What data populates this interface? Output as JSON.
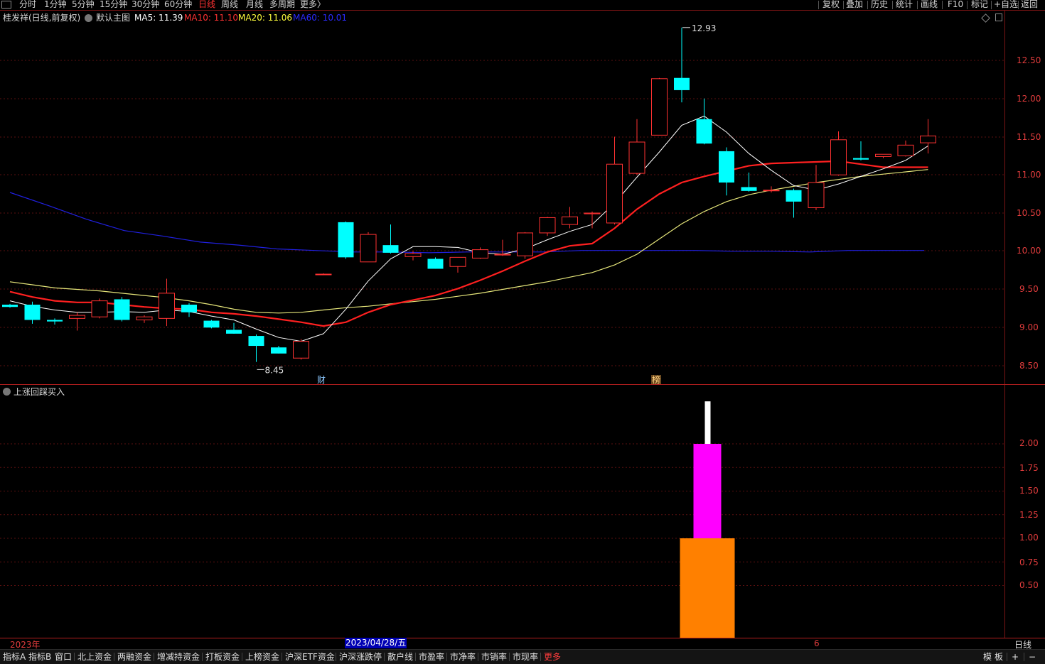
{
  "toolbar": {
    "app_icon": "window-icon",
    "periods": [
      "分时",
      "1分钟",
      "5分钟",
      "15分钟",
      "30分钟",
      "60分钟",
      "日线",
      "周线",
      "月线",
      "多周期",
      "更多"
    ],
    "active_period": "日线",
    "more_suffix": "〉",
    "right_tools": [
      "复权",
      "叠加",
      "历史",
      "统计",
      "画线",
      "F10",
      "标记",
      "+自选",
      "返回"
    ]
  },
  "main_info": {
    "stock": "桂发祥(日线,前复权)",
    "template": "默认主图",
    "ma5": "MA5: 11.39",
    "ma10": "MA10: 11.10",
    "ma20": "MA20: 11.06",
    "ma60": "MA60: 10.01"
  },
  "colors": {
    "up": "#ff3232",
    "down": "#00ffff",
    "ma5": "#ffffff",
    "ma10": "#ff2020",
    "ma20": "#e6e67a",
    "ma60": "#2020e0",
    "axis": "#e03c3c",
    "frame": "#7a1414",
    "grid": "#5a1010"
  },
  "price_axis": {
    "ticks": [
      "12.50",
      "12.00",
      "11.50",
      "11.00",
      "10.50",
      "10.00",
      "9.50",
      "9.00",
      "8.50"
    ],
    "range": [
      8.4,
      12.95
    ]
  },
  "annotations": {
    "high_label": "12.93",
    "low_label": "8.45",
    "cai_marker": "财",
    "bang_marker": "榜"
  },
  "indicator": {
    "name": "上涨回踩买入",
    "ticks": [
      "2.00",
      "1.75",
      "1.50",
      "1.25",
      "1.00",
      "0.75",
      "0.50"
    ],
    "range": [
      -0.5,
      2.4
    ]
  },
  "chart_data": {
    "type": "candlestick",
    "ohlc": [
      [
        9.3,
        9.31,
        9.26,
        9.27
      ],
      [
        9.3,
        9.34,
        9.05,
        9.1
      ],
      [
        9.1,
        9.12,
        9.04,
        9.08
      ],
      [
        9.12,
        9.2,
        8.96,
        9.16
      ],
      [
        9.14,
        9.38,
        9.12,
        9.35
      ],
      [
        9.37,
        9.4,
        9.08,
        9.1
      ],
      [
        9.1,
        9.16,
        9.06,
        9.14
      ],
      [
        9.12,
        9.64,
        9.02,
        9.45
      ],
      [
        9.3,
        9.32,
        9.14,
        9.2
      ],
      [
        9.09,
        9.1,
        8.99,
        9.0
      ],
      [
        8.97,
        9.06,
        8.92,
        8.92
      ],
      [
        8.89,
        8.91,
        8.55,
        8.76
      ],
      [
        8.74,
        8.76,
        8.66,
        8.66
      ],
      [
        8.6,
        8.85,
        8.58,
        8.82
      ],
      [
        9.7,
        9.71,
        9.69,
        9.7
      ],
      [
        10.38,
        10.39,
        9.9,
        9.92
      ],
      [
        9.86,
        10.25,
        9.87,
        10.22
      ],
      [
        10.08,
        10.35,
        9.97,
        9.98
      ],
      [
        9.93,
        10.0,
        9.88,
        9.97
      ],
      [
        9.9,
        9.92,
        9.77,
        9.77
      ],
      [
        9.8,
        9.92,
        9.72,
        9.92
      ],
      [
        9.91,
        10.05,
        9.9,
        10.02
      ],
      [
        9.95,
        10.15,
        9.94,
        9.96
      ],
      [
        9.94,
        10.25,
        9.9,
        10.24
      ],
      [
        10.24,
        10.45,
        10.2,
        10.44
      ],
      [
        10.35,
        10.58,
        10.3,
        10.45
      ],
      [
        10.49,
        10.52,
        10.3,
        10.5
      ],
      [
        10.37,
        11.5,
        10.35,
        11.14
      ],
      [
        11.02,
        11.73,
        11.0,
        11.43
      ],
      [
        11.52,
        12.27,
        11.52,
        12.26
      ],
      [
        12.27,
        12.93,
        11.95,
        12.11
      ],
      [
        11.73,
        12.0,
        11.4,
        11.41
      ],
      [
        11.31,
        11.36,
        10.73,
        10.9
      ],
      [
        10.84,
        11.03,
        10.78,
        10.79
      ],
      [
        10.8,
        10.85,
        10.77,
        10.8
      ],
      [
        10.8,
        10.82,
        10.44,
        10.65
      ],
      [
        10.57,
        11.13,
        10.54,
        10.9
      ],
      [
        11.0,
        11.57,
        10.99,
        11.46
      ],
      [
        11.22,
        11.44,
        11.19,
        11.2
      ],
      [
        11.24,
        11.25,
        11.22,
        11.27
      ],
      [
        11.25,
        11.45,
        11.24,
        11.39
      ],
      [
        11.42,
        11.73,
        11.28,
        11.51
      ]
    ],
    "ma5": [
      9.35,
      9.28,
      9.23,
      9.2,
      9.2,
      9.21,
      9.2,
      9.23,
      9.21,
      9.15,
      9.1,
      8.98,
      8.87,
      8.82,
      8.92,
      9.24,
      9.61,
      9.9,
      10.06,
      10.06,
      10.05,
      9.98,
      9.96,
      10.03,
      10.15,
      10.26,
      10.35,
      10.63,
      10.97,
      11.3,
      11.65,
      11.77,
      11.56,
      11.28,
      11.06,
      10.86,
      10.8,
      10.88,
      10.98,
      11.08,
      11.19,
      11.38
    ],
    "ma10": [
      9.47,
      9.4,
      9.35,
      9.33,
      9.33,
      9.3,
      9.27,
      9.25,
      9.24,
      9.2,
      9.18,
      9.15,
      9.11,
      9.07,
      9.02,
      9.07,
      9.2,
      9.3,
      9.36,
      9.42,
      9.51,
      9.62,
      9.74,
      9.87,
      9.99,
      10.07,
      10.1,
      10.3,
      10.55,
      10.75,
      10.9,
      10.98,
      11.05,
      11.12,
      11.15,
      11.16,
      11.17,
      11.18,
      11.14,
      11.1,
      11.1,
      11.1
    ],
    "ma20": [
      9.6,
      9.56,
      9.52,
      9.5,
      9.48,
      9.45,
      9.42,
      9.39,
      9.35,
      9.3,
      9.24,
      9.2,
      9.19,
      9.2,
      9.23,
      9.26,
      9.28,
      9.31,
      9.34,
      9.37,
      9.41,
      9.45,
      9.5,
      9.55,
      9.6,
      9.66,
      9.72,
      9.82,
      9.96,
      10.16,
      10.36,
      10.52,
      10.65,
      10.74,
      10.8,
      10.85,
      10.9,
      10.94,
      10.98,
      11.01,
      11.04,
      11.07
    ],
    "ma60": [
      10.77,
      10.6,
      10.42,
      10.27,
      10.2,
      10.12,
      10.08,
      10.03,
      10.01,
      9.99,
      9.99,
      9.98,
      9.99,
      9.99,
      9.99,
      10.01,
      10.01,
      10.01,
      10.01,
      10.0,
      10.0,
      9.99,
      10.01,
      10.01,
      10.01
    ],
    "ma60_start_index": 0,
    "indicator_bars": [
      {
        "name": "orange",
        "value": 1.0,
        "base": -0.24,
        "color": "#ff8000"
      },
      {
        "name": "magenta",
        "value": 2.0,
        "base": 1.0,
        "color": "#ff00ff"
      },
      {
        "name": "white",
        "value": 2.45,
        "base": 2.0,
        "color": "#ffffff"
      }
    ],
    "indicator_index": 31
  },
  "time_axis": {
    "year_label": "2023年",
    "cursor_date": "2023/04/28/五",
    "month_label": "6",
    "period_label": "日线"
  },
  "bottom_tabs": [
    "指标A",
    "指标B",
    "窗口",
    "北上资金",
    "两融资金",
    "增减持资金",
    "打板资金",
    "上榜资金",
    "沪深ETF资金",
    "沪深涨跌停",
    "散户线",
    "市盈率",
    "市净率",
    "市销率",
    "市现率",
    "更多"
  ],
  "bottom_right": [
    "模",
    "板",
    "+",
    "−"
  ]
}
